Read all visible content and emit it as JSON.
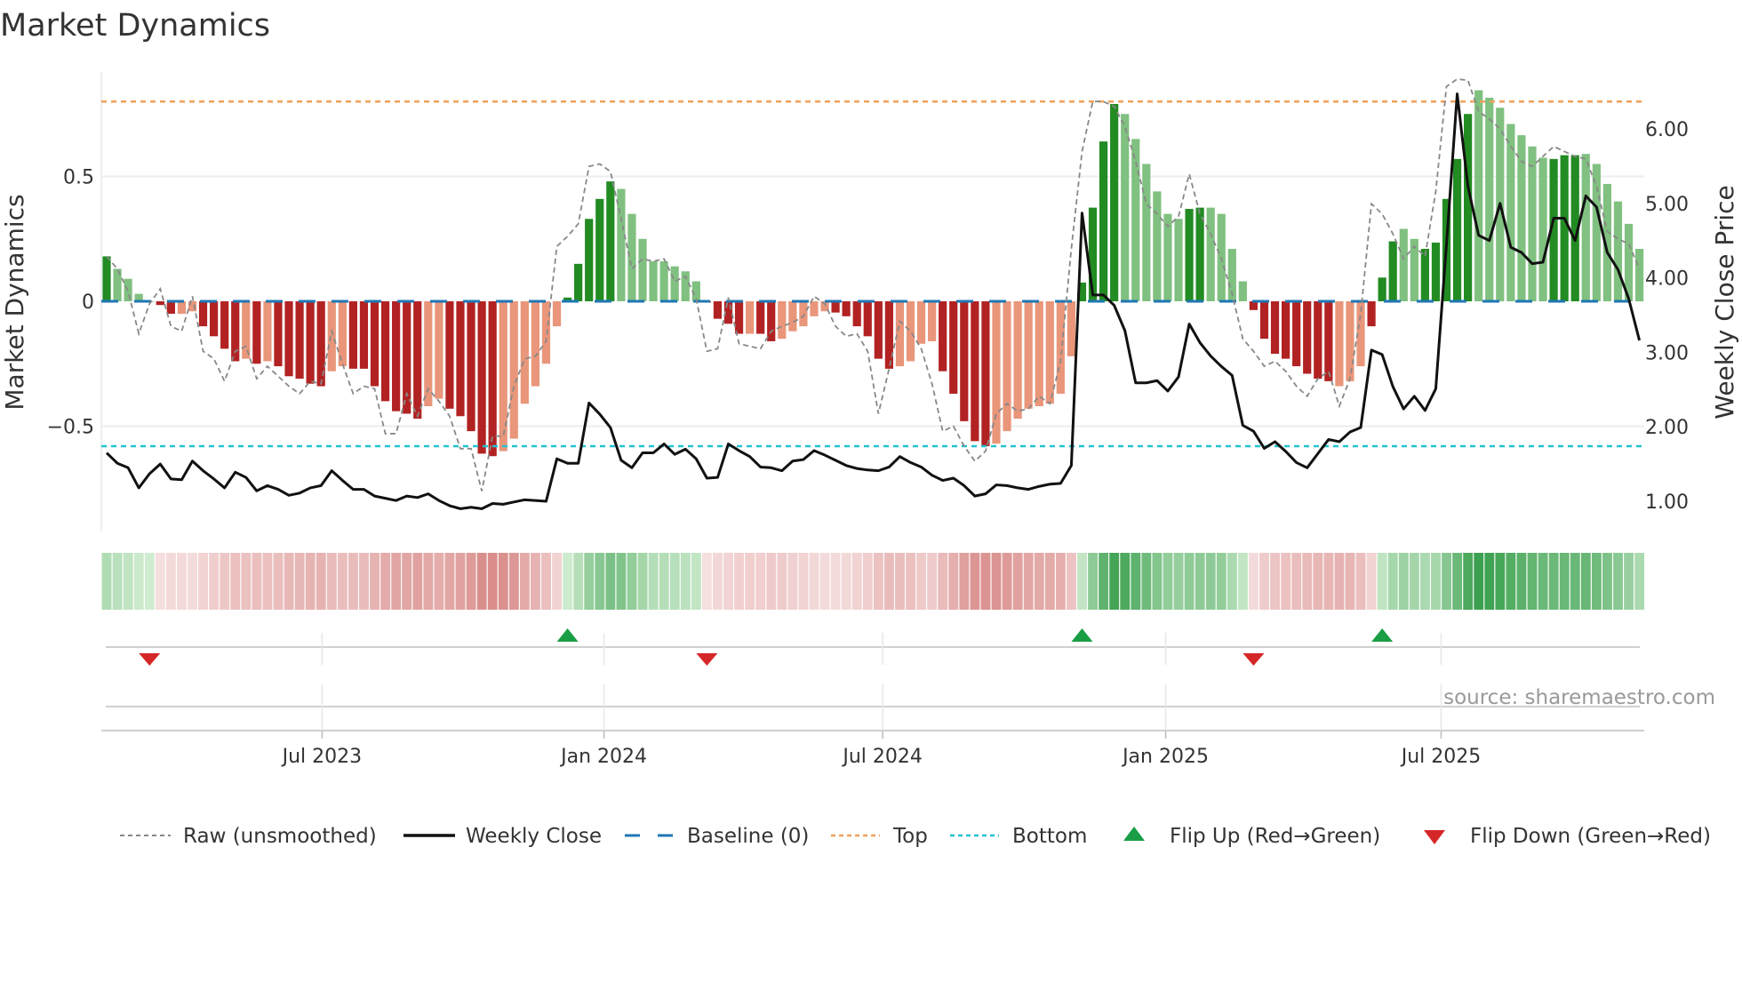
{
  "title": "Market Dynamics",
  "source": "source: sharemaestro.com",
  "colors": {
    "dark_green": "#228b22",
    "light_green": "#80c080",
    "dark_red": "#b22222",
    "light_red": "#e9967a",
    "top": "#f0a05a",
    "bottom": "#22c3d0",
    "baseline": "#1f77b4",
    "raw": "#888888",
    "close": "#111111",
    "flip_up": "#1a9e45",
    "flip_down": "#d62728"
  },
  "chart_data": {
    "type": "bar",
    "title": "Market Dynamics",
    "ylabel": "Market Dynamics",
    "y2label": "Weekly Close Price",
    "ylim": [
      -0.85,
      0.93
    ],
    "y2lim": [
      0.52,
      6.9
    ],
    "yticks": [
      {
        "v": 0.5,
        "label": "0.5"
      },
      {
        "v": 0,
        "label": "0"
      },
      {
        "v": -0.5,
        "label": "−0.5"
      }
    ],
    "y2ticks": [
      {
        "v": 1,
        "label": "1.00"
      },
      {
        "v": 2,
        "label": "2.00"
      },
      {
        "v": 3,
        "label": "3.00"
      },
      {
        "v": 4,
        "label": "4.00"
      },
      {
        "v": 5,
        "label": "5.00"
      },
      {
        "v": 6,
        "label": "6.00"
      }
    ],
    "x_unit": "week index",
    "xticks": [
      {
        "week": 20.1,
        "label": "Jul 2023"
      },
      {
        "week": 46.4,
        "label": "Jan 2024"
      },
      {
        "week": 72.4,
        "label": "Jul 2024"
      },
      {
        "week": 98.8,
        "label": "Jan 2025"
      },
      {
        "week": 124.5,
        "label": "Jul 2025"
      }
    ],
    "top_level": 0.8,
    "bottom_level": -0.58,
    "baseline": 0,
    "momentum": [
      0.18,
      0.13,
      0.09,
      0.03,
      0.0,
      -0.015,
      -0.05,
      -0.05,
      -0.04,
      -0.1,
      -0.14,
      -0.19,
      -0.24,
      -0.23,
      -0.25,
      -0.24,
      -0.26,
      -0.3,
      -0.31,
      -0.33,
      -0.34,
      -0.28,
      -0.26,
      -0.27,
      -0.27,
      -0.34,
      -0.4,
      -0.44,
      -0.45,
      -0.47,
      -0.42,
      -0.39,
      -0.43,
      -0.46,
      -0.52,
      -0.61,
      -0.62,
      -0.6,
      -0.55,
      -0.41,
      -0.34,
      -0.25,
      -0.1,
      0.015,
      0.15,
      0.33,
      0.41,
      0.48,
      0.45,
      0.35,
      0.25,
      0.16,
      0.16,
      0.14,
      0.12,
      0.08,
      -0.005,
      -0.07,
      -0.09,
      -0.13,
      -0.13,
      -0.13,
      -0.16,
      -0.15,
      -0.12,
      -0.1,
      -0.06,
      -0.04,
      -0.045,
      -0.06,
      -0.1,
      -0.14,
      -0.23,
      -0.27,
      -0.26,
      -0.24,
      -0.17,
      -0.16,
      -0.28,
      -0.37,
      -0.48,
      -0.56,
      -0.58,
      -0.57,
      -0.52,
      -0.47,
      -0.43,
      -0.42,
      -0.41,
      -0.37,
      -0.22,
      0.075,
      0.375,
      0.64,
      0.79,
      0.75,
      0.65,
      0.55,
      0.44,
      0.35,
      0.33,
      0.37,
      0.375,
      0.375,
      0.35,
      0.21,
      0.08,
      -0.035,
      -0.15,
      -0.21,
      -0.23,
      -0.26,
      -0.29,
      -0.31,
      -0.32,
      -0.34,
      -0.32,
      -0.26,
      -0.1,
      0.095,
      0.24,
      0.29,
      0.25,
      0.21,
      0.235,
      0.41,
      0.57,
      0.75,
      0.845,
      0.815,
      0.775,
      0.71,
      0.665,
      0.62,
      0.575,
      0.57,
      0.585,
      0.585,
      0.59,
      0.55,
      0.47,
      0.4,
      0.31,
      0.21
    ],
    "momentum_rising": [
      1,
      0,
      0,
      0,
      0,
      1,
      1,
      0,
      0,
      1,
      1,
      1,
      1,
      0,
      1,
      0,
      1,
      1,
      1,
      1,
      1,
      0,
      0,
      1,
      1,
      1,
      1,
      1,
      1,
      1,
      0,
      0,
      1,
      1,
      1,
      1,
      1,
      0,
      0,
      0,
      0,
      0,
      0,
      1,
      1,
      1,
      1,
      1,
      0,
      0,
      0,
      0,
      0,
      0,
      0,
      0,
      1,
      1,
      1,
      1,
      0,
      1,
      1,
      0,
      0,
      0,
      0,
      0,
      1,
      1,
      1,
      1,
      1,
      1,
      0,
      0,
      0,
      0,
      1,
      1,
      1,
      1,
      1,
      0,
      0,
      0,
      0,
      0,
      0,
      0,
      0,
      1,
      1,
      1,
      1,
      0,
      0,
      0,
      0,
      0,
      0,
      1,
      1,
      0,
      0,
      0,
      0,
      1,
      1,
      1,
      1,
      1,
      1,
      1,
      1,
      0,
      0,
      0,
      1,
      1,
      1,
      0,
      0,
      1,
      1,
      1,
      1,
      1,
      0,
      0,
      0,
      0,
      0,
      0,
      0,
      1,
      1,
      1,
      0,
      0,
      0,
      0,
      0
    ],
    "raw": [
      0.18,
      0.13,
      0.04,
      -0.13,
      -0.01,
      0.05,
      -0.1,
      -0.12,
      0.02,
      -0.2,
      -0.23,
      -0.32,
      -0.2,
      -0.18,
      -0.31,
      -0.26,
      -0.3,
      -0.34,
      -0.37,
      -0.32,
      -0.33,
      -0.12,
      -0.25,
      -0.37,
      -0.34,
      -0.35,
      -0.53,
      -0.53,
      -0.37,
      -0.46,
      -0.35,
      -0.4,
      -0.46,
      -0.59,
      -0.59,
      -0.76,
      -0.54,
      -0.54,
      -0.34,
      -0.23,
      -0.22,
      -0.16,
      0.22,
      0.26,
      0.31,
      0.54,
      0.55,
      0.52,
      0.33,
      0.13,
      0.17,
      0.16,
      0.17,
      0.08,
      0.1,
      0.01,
      -0.2,
      -0.19,
      0.015,
      -0.17,
      -0.18,
      -0.19,
      -0.12,
      -0.1,
      -0.085,
      -0.06,
      0.02,
      -0.01,
      -0.1,
      -0.14,
      -0.13,
      -0.2,
      -0.45,
      -0.27,
      -0.08,
      -0.12,
      -0.19,
      -0.33,
      -0.52,
      -0.5,
      -0.58,
      -0.64,
      -0.6,
      -0.45,
      -0.41,
      -0.44,
      -0.43,
      -0.38,
      -0.41,
      -0.24,
      0.21,
      0.6,
      0.8,
      0.8,
      0.78,
      0.7,
      0.56,
      0.39,
      0.35,
      0.3,
      0.34,
      0.51,
      0.35,
      0.27,
      0.17,
      0.03,
      -0.15,
      -0.2,
      -0.26,
      -0.24,
      -0.28,
      -0.34,
      -0.38,
      -0.31,
      -0.28,
      -0.42,
      -0.31,
      -0.05,
      0.39,
      0.35,
      0.27,
      0.17,
      0.22,
      0.18,
      0.44,
      0.86,
      0.89,
      0.885,
      0.76,
      0.73,
      0.69,
      0.62,
      0.56,
      0.54,
      0.58,
      0.62,
      0.6,
      0.58,
      0.57,
      0.46,
      0.28,
      0.25,
      0.23,
      0.13
    ],
    "weekly_close": [
      1.65,
      1.51,
      1.45,
      1.18,
      1.37,
      1.5,
      1.3,
      1.29,
      1.54,
      1.41,
      1.3,
      1.18,
      1.39,
      1.32,
      1.14,
      1.21,
      1.16,
      1.08,
      1.11,
      1.18,
      1.21,
      1.41,
      1.28,
      1.16,
      1.16,
      1.07,
      1.04,
      1.01,
      1.07,
      1.05,
      1.1,
      1.01,
      0.94,
      0.9,
      0.92,
      0.9,
      0.97,
      0.96,
      0.99,
      1.02,
      1.01,
      1.0,
      1.57,
      1.51,
      1.51,
      2.32,
      2.17,
      1.99,
      1.55,
      1.45,
      1.65,
      1.65,
      1.77,
      1.63,
      1.7,
      1.57,
      1.31,
      1.32,
      1.77,
      1.68,
      1.6,
      1.46,
      1.45,
      1.41,
      1.54,
      1.56,
      1.68,
      1.62,
      1.55,
      1.48,
      1.44,
      1.42,
      1.41,
      1.46,
      1.6,
      1.52,
      1.46,
      1.35,
      1.28,
      1.31,
      1.21,
      1.07,
      1.1,
      1.22,
      1.21,
      1.18,
      1.16,
      1.2,
      1.23,
      1.24,
      1.48,
      4.87,
      3.77,
      3.77,
      3.63,
      3.29,
      2.59,
      2.59,
      2.62,
      2.48,
      2.67,
      3.38,
      3.13,
      2.95,
      2.81,
      2.69,
      2.02,
      1.94,
      1.71,
      1.8,
      1.67,
      1.52,
      1.45,
      1.64,
      1.83,
      1.8,
      1.93,
      1.99,
      3.03,
      2.97,
      2.54,
      2.24,
      2.41,
      2.22,
      2.51,
      4.45,
      6.47,
      5.23,
      4.57,
      4.5,
      5.0,
      4.41,
      4.34,
      4.19,
      4.21,
      4.8,
      4.8,
      4.5,
      5.1,
      4.95,
      4.34,
      4.11,
      3.72,
      3.16
    ],
    "flips": [
      {
        "week": 4,
        "dir": "down"
      },
      {
        "week": 43,
        "dir": "up"
      },
      {
        "week": 56,
        "dir": "down"
      },
      {
        "week": 91,
        "dir": "up"
      },
      {
        "week": 107,
        "dir": "down"
      },
      {
        "week": 119,
        "dir": "up"
      }
    ],
    "legend": {
      "position": "bottom",
      "raw": "Raw (unsmoothed)",
      "close": "Weekly Close",
      "baseline": "Baseline (0)",
      "top": "Top",
      "bottom": "Bottom",
      "flip_up": "Flip Up (Red→Green)",
      "flip_down": "Flip Down (Green→Red)"
    }
  }
}
